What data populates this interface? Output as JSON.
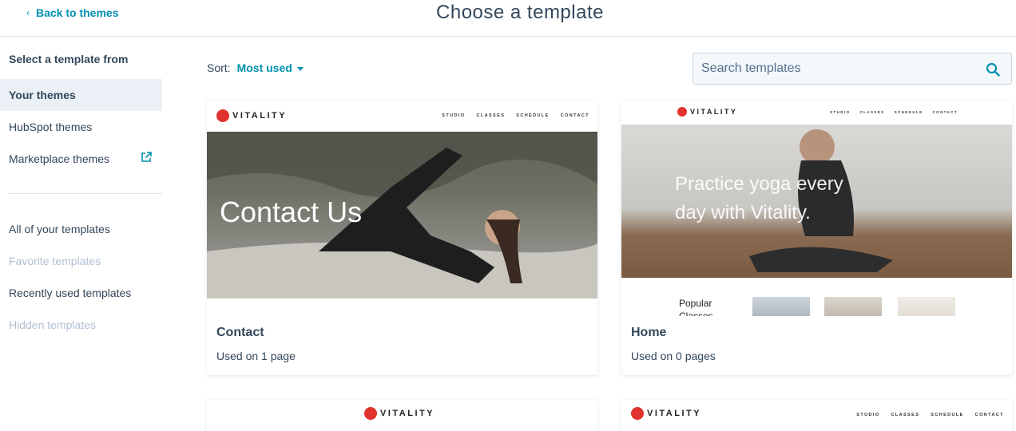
{
  "header": {
    "back_label": "Back to themes",
    "title": "Choose a template"
  },
  "sidebar": {
    "heading": "Select a template from",
    "sources": [
      {
        "label": "Your themes",
        "active": true
      },
      {
        "label": "HubSpot themes",
        "active": false
      },
      {
        "label": "Marketplace themes",
        "active": false
      }
    ],
    "filters": [
      {
        "label": "All of your templates",
        "disabled": false
      },
      {
        "label": "Favorite templates",
        "disabled": true
      },
      {
        "label": "Recently used templates",
        "disabled": false
      },
      {
        "label": "Hidden templates",
        "disabled": true
      }
    ]
  },
  "sort": {
    "label": "Sort:",
    "value": "Most used"
  },
  "search": {
    "placeholder": "Search templates"
  },
  "preview": {
    "brand": "VITALITY",
    "nav": [
      "STUDIO",
      "CLASSES",
      "SCHEDULE",
      "CONTACT"
    ]
  },
  "templates": [
    {
      "name": "Contact",
      "usage": "Used on 1 page",
      "hero_text": "Contact Us"
    },
    {
      "name": "Home",
      "usage": "Used on 0 pages",
      "hero_text_line1": "Practice yoga every",
      "hero_text_line2": "day with Vitality.",
      "section_label": "Popular",
      "section_label_2": "Classes"
    }
  ],
  "colors": {
    "accent": "#0091ae",
    "text": "#33475b",
    "active_bg": "#eaf0f6",
    "disabled_text": "#b0c1d4",
    "brand_red": "#e2322d"
  }
}
